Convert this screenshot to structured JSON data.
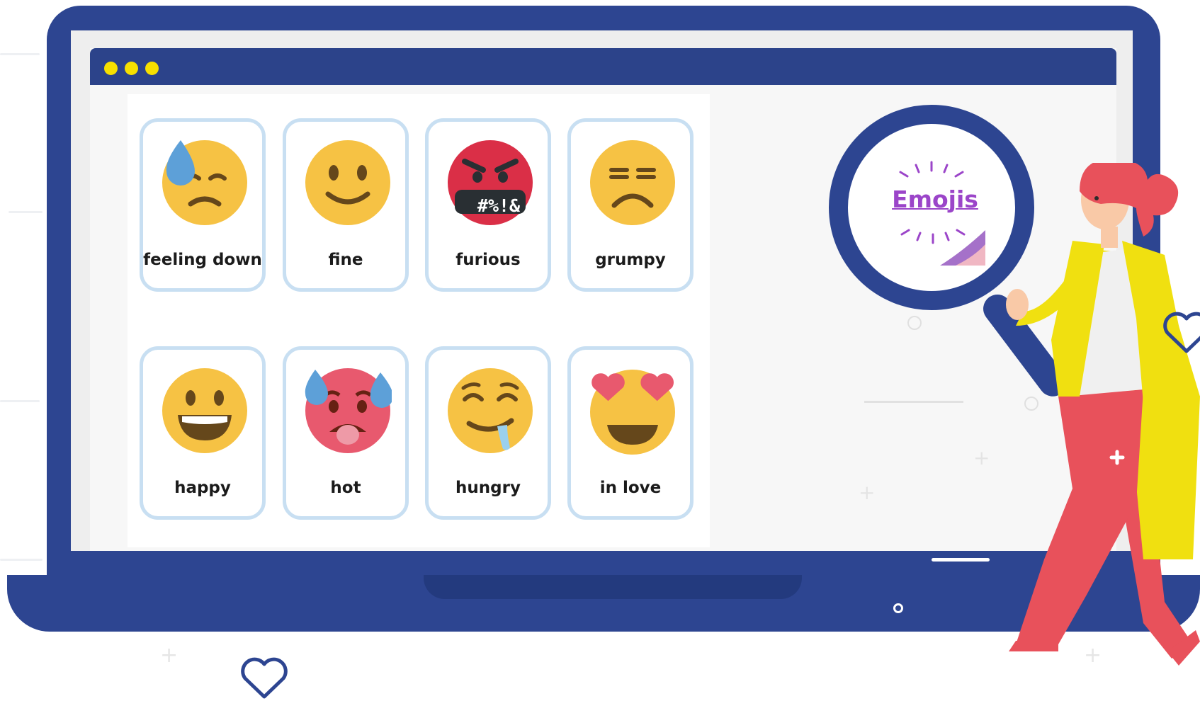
{
  "browser": {
    "window_dots": [
      "dot-1",
      "dot-2",
      "dot-3"
    ]
  },
  "emoji_grid": {
    "cards": [
      {
        "label": "feeling down",
        "icon": "downcast-sweat-face-icon"
      },
      {
        "label": "fine",
        "icon": "slightly-smiling-face-icon"
      },
      {
        "label": "furious",
        "icon": "cursing-face-icon",
        "symbols": "#%!&"
      },
      {
        "label": "grumpy",
        "icon": "persevering-face-icon"
      },
      {
        "label": "happy",
        "icon": "grinning-face-icon"
      },
      {
        "label": "hot",
        "icon": "hot-face-icon"
      },
      {
        "label": "hungry",
        "icon": "drooling-face-icon"
      },
      {
        "label": "in love",
        "icon": "heart-eyes-face-icon"
      }
    ]
  },
  "magnifier": {
    "sticker_text": "Emojis"
  },
  "colors": {
    "laptop": "#2d4591",
    "emoji_yellow": "#f6c244",
    "furious_red": "#da2f47",
    "hot_pink": "#e8596e",
    "card_border": "#c8dff2",
    "window_dot": "#f7e000",
    "sticker_text": "#9b45c9",
    "woman_pants": "#e8515b",
    "woman_coat": "#f0e010"
  }
}
